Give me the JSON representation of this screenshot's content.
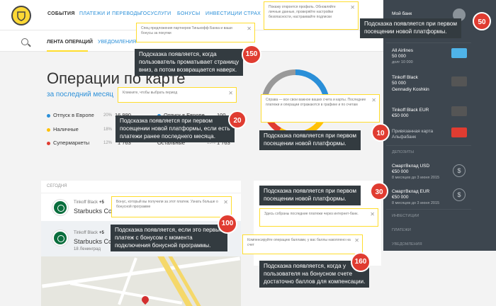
{
  "nav": {
    "items": [
      "События",
      "Платежи и переводы",
      "Госуслуги",
      "Бонусы",
      "Инвестиции",
      "Страх"
    ]
  },
  "subnav": {
    "tabs": [
      "Лента операций",
      "Уведомления"
    ]
  },
  "operations": {
    "title": "Операции по карте",
    "period": "за последний месяц",
    "legend": [
      {
        "label": "Отпуск в Европе",
        "pct": "20%",
        "value": "16 990",
        "color": "#2a8fd8"
      },
      {
        "label": "Наличные",
        "pct": "18%",
        "value": "",
        "color": "#ffc107"
      },
      {
        "label": "Супермаркеты",
        "pct": "12%",
        "value": "1 763",
        "color": "#e03c31"
      }
    ],
    "legend_right": [
      {
        "label": "Отпуск в Европе",
        "pct": "",
        "value": "100",
        "color": "#2a8fd8"
      },
      {
        "label": "Остальные",
        "pct": "15%",
        "value": "1 763",
        "color": "#999999"
      }
    ]
  },
  "feed": {
    "date_header": "Сегодня",
    "items": [
      {
        "meta": "Tinkoff Black",
        "badge": "+5",
        "merchant": "Starbucks Coffe"
      },
      {
        "meta": "Tinkoff Black",
        "badge": "+5",
        "merchant": "Starbucks Co",
        "address": "18 Ленинград"
      }
    ]
  },
  "sidebar": {
    "my_bank": "Мой банк",
    "items": [
      {
        "name": "All Airlines",
        "line2": "50 000",
        "line3": "долг 10 000",
        "card_color": "#4fb3e8"
      },
      {
        "name": "Tinkoff Black",
        "line2": "50 000",
        "line3": "Gennadiy Koshkin",
        "card_color": "#555555"
      },
      {
        "name": "Tinkoff Black EUR",
        "line2": "€50 000",
        "line3": "",
        "card_color": "#555555"
      },
      {
        "name": "Привязанная карта",
        "line2": "Альфабанк",
        "line3": "",
        "card_color": "#e03c31"
      }
    ],
    "section_deposits": "Депозиты",
    "deposits": [
      {
        "name": "СмартВклад USD",
        "line2": "€50 000",
        "line3": "8 месяцев до 3 июня 2015",
        "icon": "$"
      },
      {
        "name": "СмартВклад EUR",
        "line2": "€50 000",
        "line3": "8 месяцев до 3 июня 2015",
        "icon": "$"
      }
    ],
    "section_investments": "Инвестиции",
    "section_payments": "Платежи",
    "section_notifications": "Уведомления"
  },
  "hints": {
    "h1": "Спец предложения партнеров Тинькофф Банка и ваши бонусы за покупки",
    "h2": "Покажу откроется профиль. Обновляйте личные данные, проверяйте настройки безопасности, настраивайте подписки",
    "h3": "Кликните, чтобы выбрать период",
    "h4": "Справа — все свои важное ваших счета и карты. Последние платежи и операции отражаются в графике и по счетам",
    "h5": "Бонус, который вы получили за этот платеж. Узнать больше о бонусной программе",
    "h6": "Здесь собраны последние платежи через интернет-банк.",
    "h7": "Компенсируйте операцию баллами, у вас баллы накоплено на счет"
  },
  "annotations": [
    {
      "text": [
        "Подсказка появляется  при первом",
        "посещении новой платформы."
      ],
      "badge": "50"
    },
    {
      "text": [
        "Подсказка появляется, когда",
        "пользователь проматывает страницу",
        "вниз, а потом возвращается наверх."
      ],
      "badge": "150"
    },
    {
      "text": [
        "Подсказка появляется  при первом",
        "посещении новой платформы, если есть",
        "платежи ранее последнего месяца."
      ],
      "badge": "20"
    },
    {
      "text": [
        "Подсказка появляется  при первом",
        "посещении новой платформы."
      ],
      "badge": "10"
    },
    {
      "text": [
        "Подсказка появляется  при первом",
        "посещении новой платформы."
      ],
      "badge": "30"
    },
    {
      "text": [
        "Подсказка появляется, если это первые",
        "платеж с бонусом с момента",
        "подключения бонусной программы."
      ],
      "badge": "100"
    },
    {
      "text": [
        "Подсказка появляется, когда у",
        "пользователя на бонусном счете",
        "достаточно баллов для компенсации."
      ],
      "badge": "160"
    }
  ],
  "chart_data": {
    "type": "pie",
    "categories": [
      "Отпуск в Европе",
      "Наличные",
      "Супермаркеты",
      "Остальные"
    ],
    "values": [
      20,
      18,
      12,
      15
    ],
    "colors": [
      "#2a8fd8",
      "#ffc107",
      "#e03c31",
      "#999999"
    ]
  }
}
